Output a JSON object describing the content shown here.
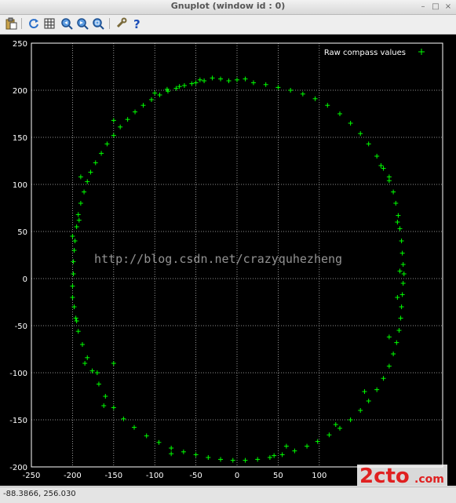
{
  "window": {
    "title": "Gnuplot (window id : 0)",
    "minimize_glyph": "–",
    "maximize_glyph": "□",
    "close_glyph": "×"
  },
  "toolbar": {
    "buttons": [
      {
        "name": "copy-to-clipboard-button",
        "icon": "clipboard-icon"
      },
      {
        "name": "replot-button",
        "icon": "refresh-icon"
      },
      {
        "name": "toggle-grid-button",
        "icon": "grid-icon"
      },
      {
        "name": "previous-zoom-button",
        "icon": "zoom-previous-icon"
      },
      {
        "name": "next-zoom-button",
        "icon": "zoom-next-icon"
      },
      {
        "name": "autoscale-button",
        "icon": "zoom-fit-icon"
      },
      {
        "name": "settings-button",
        "icon": "wrench-icon"
      },
      {
        "name": "help-button",
        "icon": "help-icon"
      }
    ]
  },
  "status": {
    "coordinates": "-88.3866, 256.030"
  },
  "watermark": {
    "text": "http://blog.csdn.net/crazyquhezheng",
    "corner_logo": "2cto",
    "corner_domain": ".com"
  },
  "chart_data": {
    "type": "scatter",
    "title": "",
    "xlabel": "",
    "ylabel": "",
    "xlim": [
      -250,
      250
    ],
    "ylim": [
      -200,
      250
    ],
    "xticks": [
      -250,
      -200,
      -150,
      -100,
      -50,
      0,
      50,
      100
    ],
    "yticks": [
      -200,
      -150,
      -100,
      -50,
      0,
      50,
      100,
      150,
      200,
      250
    ],
    "xtick_labels": [
      "-250",
      "-200",
      "-150",
      "-100",
      "-50",
      "0",
      "50",
      "100"
    ],
    "ytick_labels": [
      "-200",
      "-150",
      "-100",
      "-50",
      "0",
      "50",
      "100",
      "150",
      "200",
      "250"
    ],
    "grid": true,
    "legend_position": "top-right",
    "marker": "+",
    "colors": {
      "background": "#000000",
      "axes": "#ffffff",
      "grid": "#bdbdbd",
      "series": "#00ff00"
    },
    "series": [
      {
        "name": "Raw compass values",
        "points": [
          [
            -30,
            213
          ],
          [
            -20,
            212
          ],
          [
            -10,
            210
          ],
          [
            0,
            211
          ],
          [
            10,
            212
          ],
          [
            -40,
            210
          ],
          [
            -55,
            207
          ],
          [
            -70,
            204
          ],
          [
            -85,
            201
          ],
          [
            -100,
            197
          ],
          [
            20,
            208
          ],
          [
            35,
            206
          ],
          [
            50,
            203
          ],
          [
            65,
            200
          ],
          [
            80,
            196
          ],
          [
            95,
            191
          ],
          [
            110,
            184
          ],
          [
            125,
            175
          ],
          [
            138,
            165
          ],
          [
            150,
            154
          ],
          [
            160,
            143
          ],
          [
            170,
            130
          ],
          [
            178,
            117
          ],
          [
            185,
            104
          ],
          [
            190,
            92
          ],
          [
            193,
            80
          ],
          [
            196,
            67
          ],
          [
            198,
            53
          ],
          [
            200,
            40
          ],
          [
            201,
            27
          ],
          [
            202,
            15
          ],
          [
            203,
            5
          ],
          [
            202,
            -5
          ],
          [
            201,
            -17
          ],
          [
            200,
            -30
          ],
          [
            199,
            -42
          ],
          [
            197,
            -55
          ],
          [
            194,
            -68
          ],
          [
            190,
            -80
          ],
          [
            185,
            -93
          ],
          [
            178,
            -106
          ],
          [
            170,
            -118
          ],
          [
            160,
            -130
          ],
          [
            150,
            -140
          ],
          [
            138,
            -150
          ],
          [
            125,
            -159
          ],
          [
            112,
            -166
          ],
          [
            98,
            -173
          ],
          [
            85,
            -178
          ],
          [
            70,
            -183
          ],
          [
            55,
            -187
          ],
          [
            40,
            -190
          ],
          [
            25,
            -192
          ],
          [
            10,
            -193
          ],
          [
            -5,
            -193
          ],
          [
            -20,
            -192
          ],
          [
            -35,
            -190
          ],
          [
            -50,
            -187
          ],
          [
            -65,
            -184
          ],
          [
            -80,
            -180
          ],
          [
            -95,
            -174
          ],
          [
            -110,
            -167
          ],
          [
            -125,
            -158
          ],
          [
            -138,
            -149
          ],
          [
            -150,
            -137
          ],
          [
            -160,
            -125
          ],
          [
            -168,
            -112
          ],
          [
            -176,
            -98
          ],
          [
            -182,
            -84
          ],
          [
            -188,
            -70
          ],
          [
            -193,
            -56
          ],
          [
            -196,
            -42
          ],
          [
            -198,
            -30
          ],
          [
            -200,
            -20
          ],
          [
            -200,
            -8
          ],
          [
            -199,
            5
          ],
          [
            -199,
            18
          ],
          [
            -198,
            30
          ],
          [
            -197,
            40
          ],
          [
            -195,
            55
          ],
          [
            -193,
            68
          ],
          [
            -190,
            80
          ],
          [
            -186,
            92
          ],
          [
            -182,
            103
          ],
          [
            -178,
            113
          ],
          [
            -172,
            123
          ],
          [
            -165,
            133
          ],
          [
            -158,
            143
          ],
          [
            -150,
            152
          ],
          [
            -142,
            161
          ],
          [
            -133,
            169
          ],
          [
            -124,
            177
          ],
          [
            -114,
            184
          ],
          [
            -104,
            190
          ],
          [
            -94,
            195
          ],
          [
            -84,
            199
          ],
          [
            -74,
            202
          ],
          [
            -64,
            205
          ],
          [
            -50,
            208
          ],
          [
            -45,
            211
          ],
          [
            -150,
            168
          ],
          [
            -190,
            108
          ],
          [
            -192,
            62
          ],
          [
            -200,
            45
          ],
          [
            -195,
            -45
          ],
          [
            -185,
            -90
          ],
          [
            -170,
            -100
          ],
          [
            -150,
            -90
          ],
          [
            -162,
            -135
          ],
          [
            -80,
            -186
          ],
          [
            45,
            -188
          ],
          [
            60,
            -178
          ],
          [
            120,
            -155
          ],
          [
            155,
            -120
          ],
          [
            185,
            -62
          ],
          [
            195,
            -20
          ],
          [
            198,
            8
          ],
          [
            195,
            60
          ],
          [
            185,
            108
          ],
          [
            175,
            120
          ]
        ]
      }
    ]
  }
}
